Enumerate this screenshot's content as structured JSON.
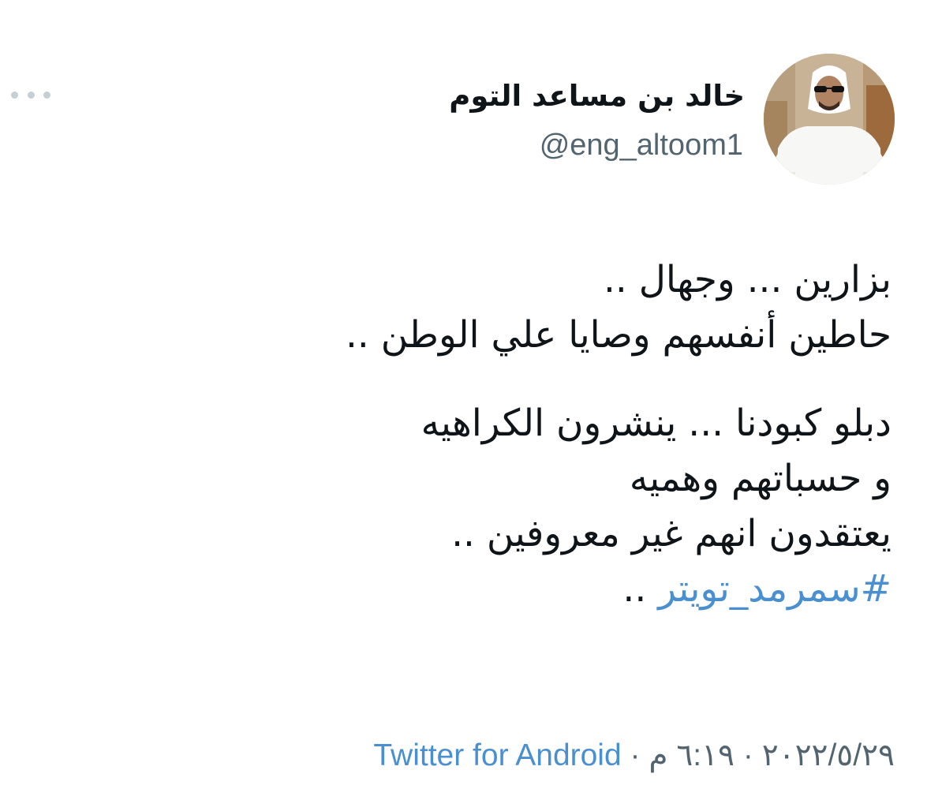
{
  "user": {
    "display_name": "خالد بن مساعد التوم",
    "handle": "@eng_altoom1"
  },
  "more_icon": "more-horizontal-icon",
  "tweet": {
    "lines_p1": [
      "بزارين ... وجهال ..",
      "حاطين أنفسهم وصايا علي الوطن .."
    ],
    "lines_p2": [
      "دبلو كبودنا ... ينشرون الكراهيه",
      "و حسباتهم وهميه",
      "يعتقدون انهم غير معروفين .."
    ],
    "hashtag": "#سمرمد_تويتر",
    "hashtag_suffix": " .."
  },
  "meta": {
    "date": "٢٠٢٢/٥/٢٩",
    "separator1": " · ",
    "time": "٦:١٩ م",
    "separator2": " · ",
    "source": "Twitter for Android"
  },
  "colors": {
    "text": "#0f1419",
    "secondary": "#536471",
    "link": "#4a8fd0",
    "dots": "#c4cfd6"
  }
}
